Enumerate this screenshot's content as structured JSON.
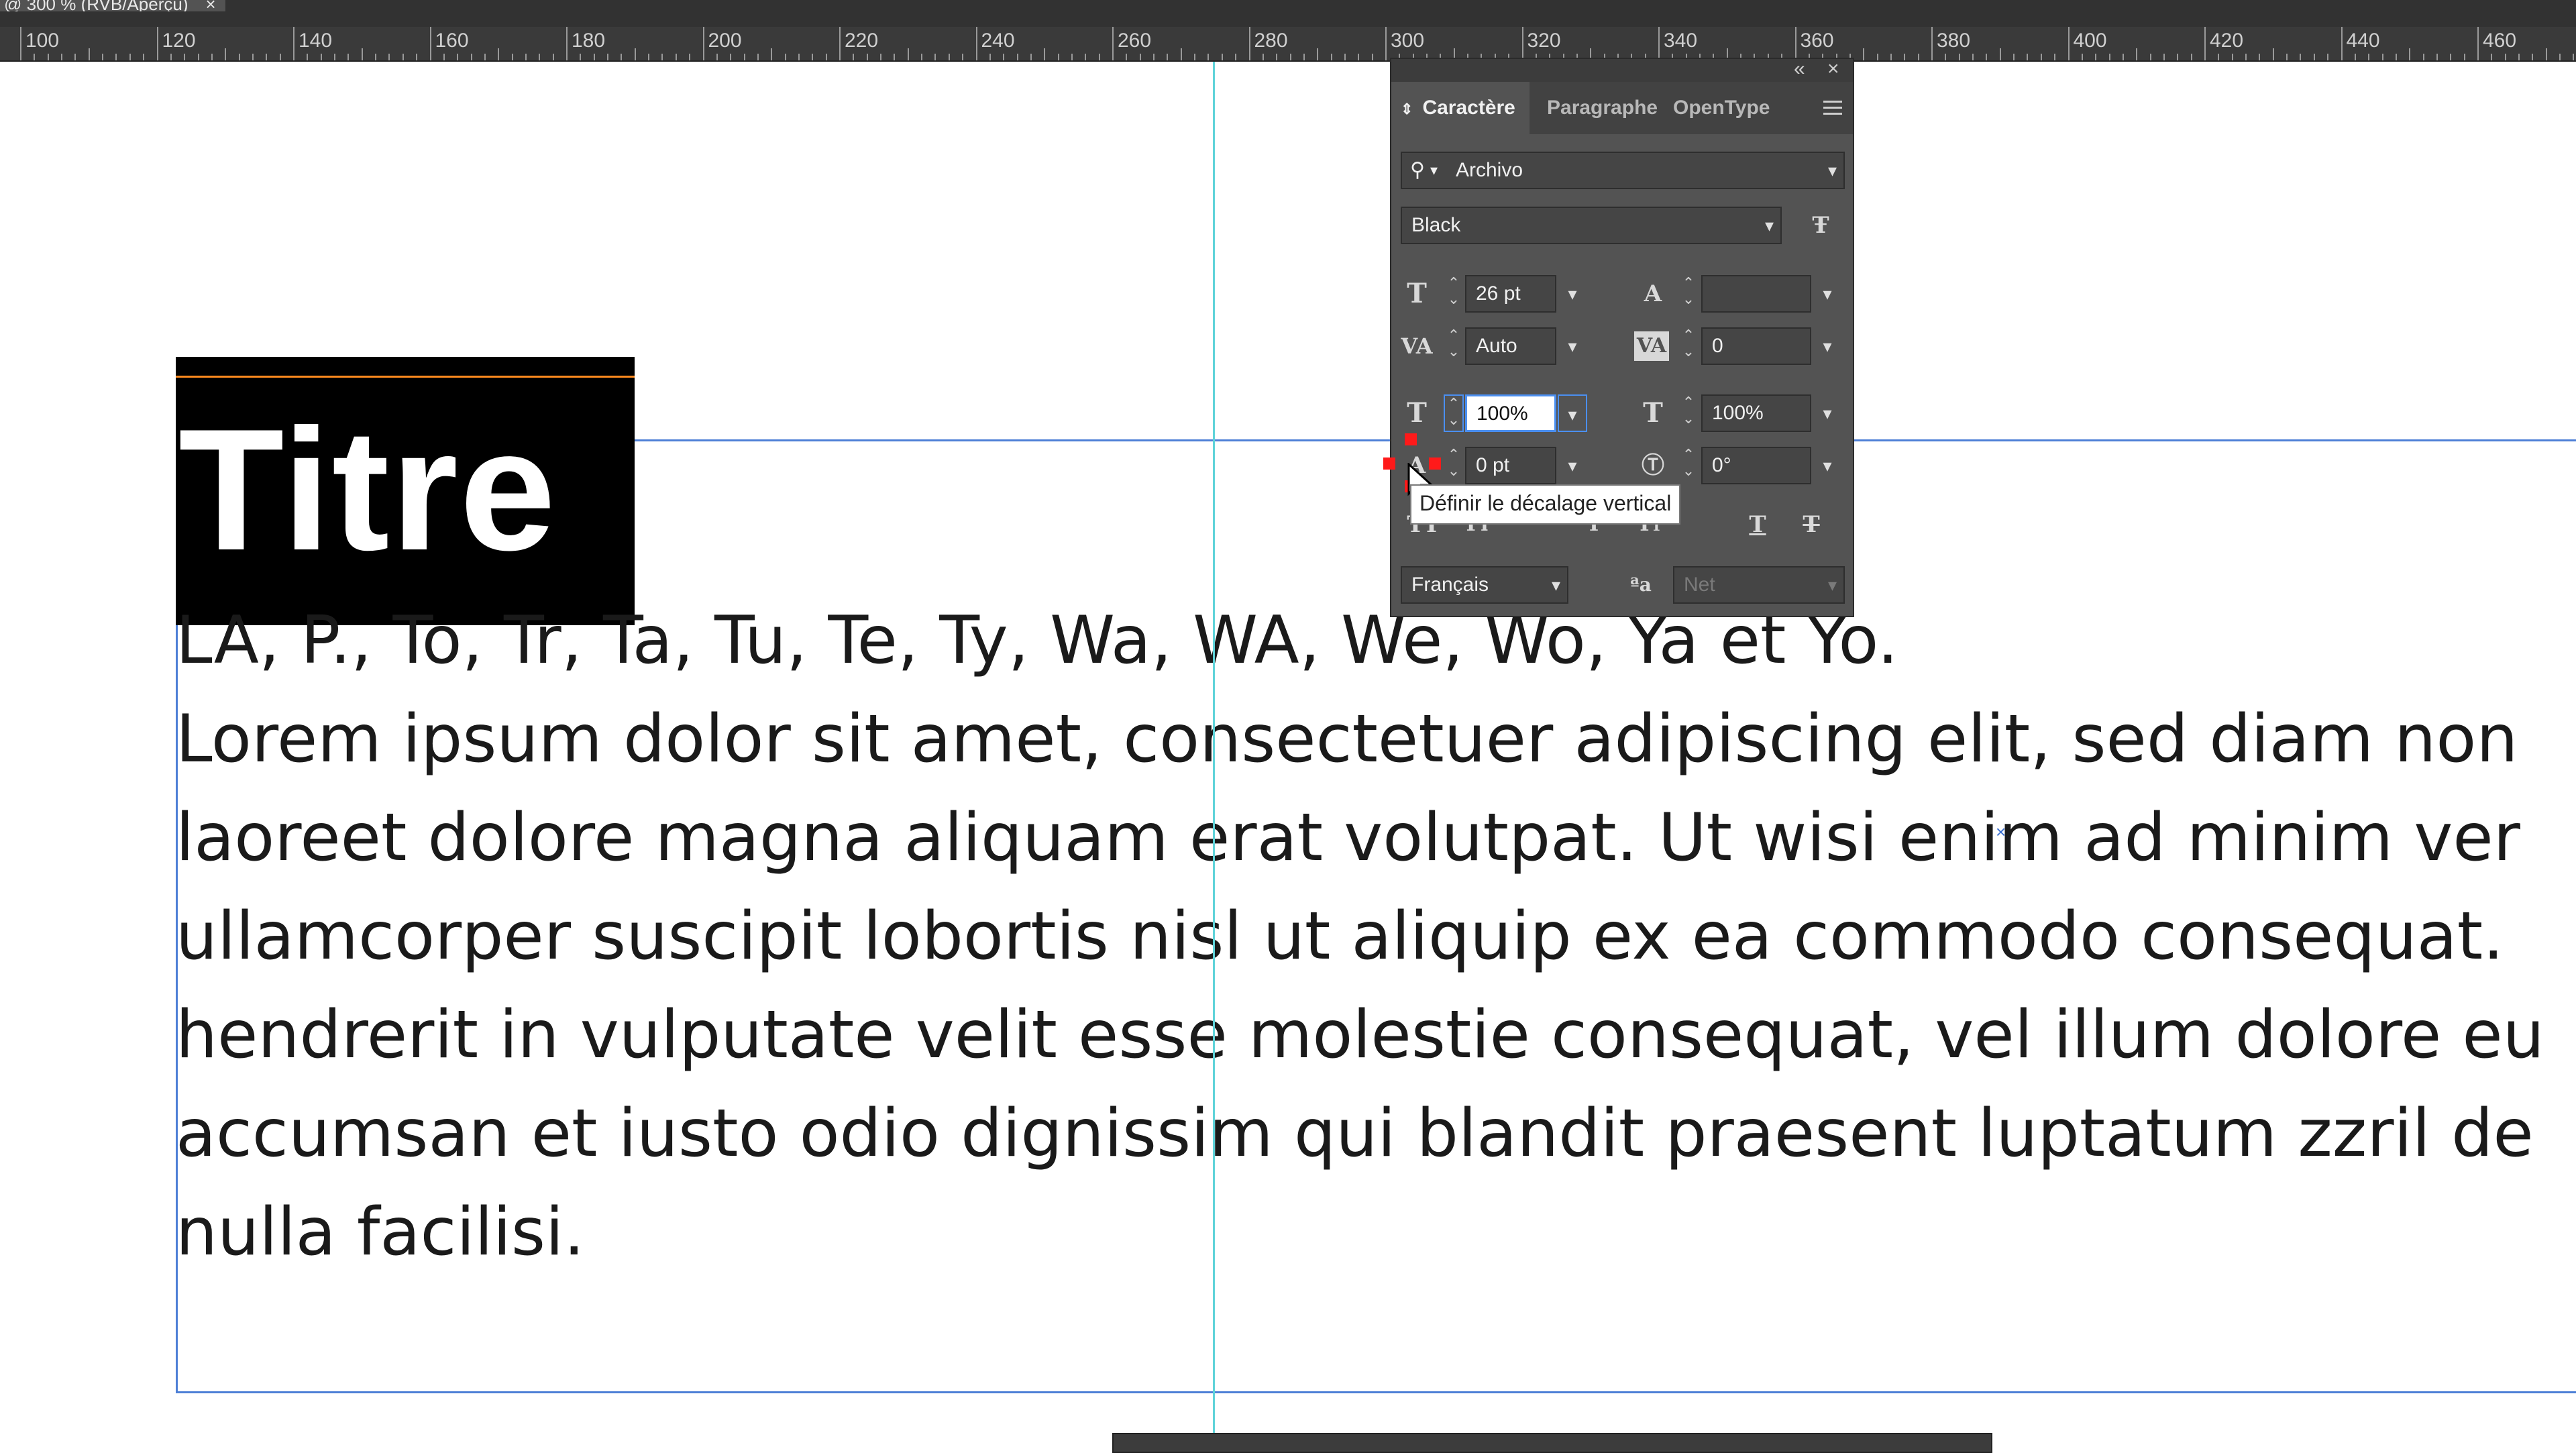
{
  "document_tab": {
    "title": "@ 300 % (RVB/Aperçu)",
    "close": "×"
  },
  "ruler": {
    "labels": [
      "100",
      "120",
      "140",
      "160",
      "180",
      "200",
      "220",
      "240",
      "260",
      "280",
      "300",
      "320",
      "340",
      "360",
      "380",
      "400",
      "420",
      "440",
      "460"
    ]
  },
  "canvas": {
    "title": "Titre",
    "body_lines": [
      "LA, P., To, Tr, Ta, Tu, Te, Ty, Wa, WA, We, Wo, Ya et Yo.",
      "Lorem ipsum dolor sit amet, consectetuer adipiscing elit, sed diam non",
      "laoreet dolore magna aliquam erat volutpat. Ut wisi enim ad minim ver",
      "ullamcorper suscipit lobortis nisl ut aliquip ex ea commodo consequat.",
      "hendrerit in vulputate velit esse molestie consequat, vel illum dolore eu",
      "accumsan et iusto odio dignissim qui blandit praesent luptatum zzril de",
      "nulla facilisi."
    ],
    "small_mark": "×"
  },
  "panel": {
    "collapse": "«",
    "close": "×",
    "tabs": [
      "Caractère",
      "Paragraphe",
      "OpenType"
    ],
    "active_tab": 0,
    "font_family": "Archivo",
    "font_style": "Black",
    "font_size": "26 pt",
    "leading": "",
    "kerning": "Auto",
    "tracking": "0",
    "vertical_scale": "100%",
    "horizontal_scale": "100%",
    "baseline_shift": "0 pt",
    "rotation": "0°",
    "language": "Français",
    "antialias": "Net",
    "tooltip": "Définir le décalage vertical"
  }
}
